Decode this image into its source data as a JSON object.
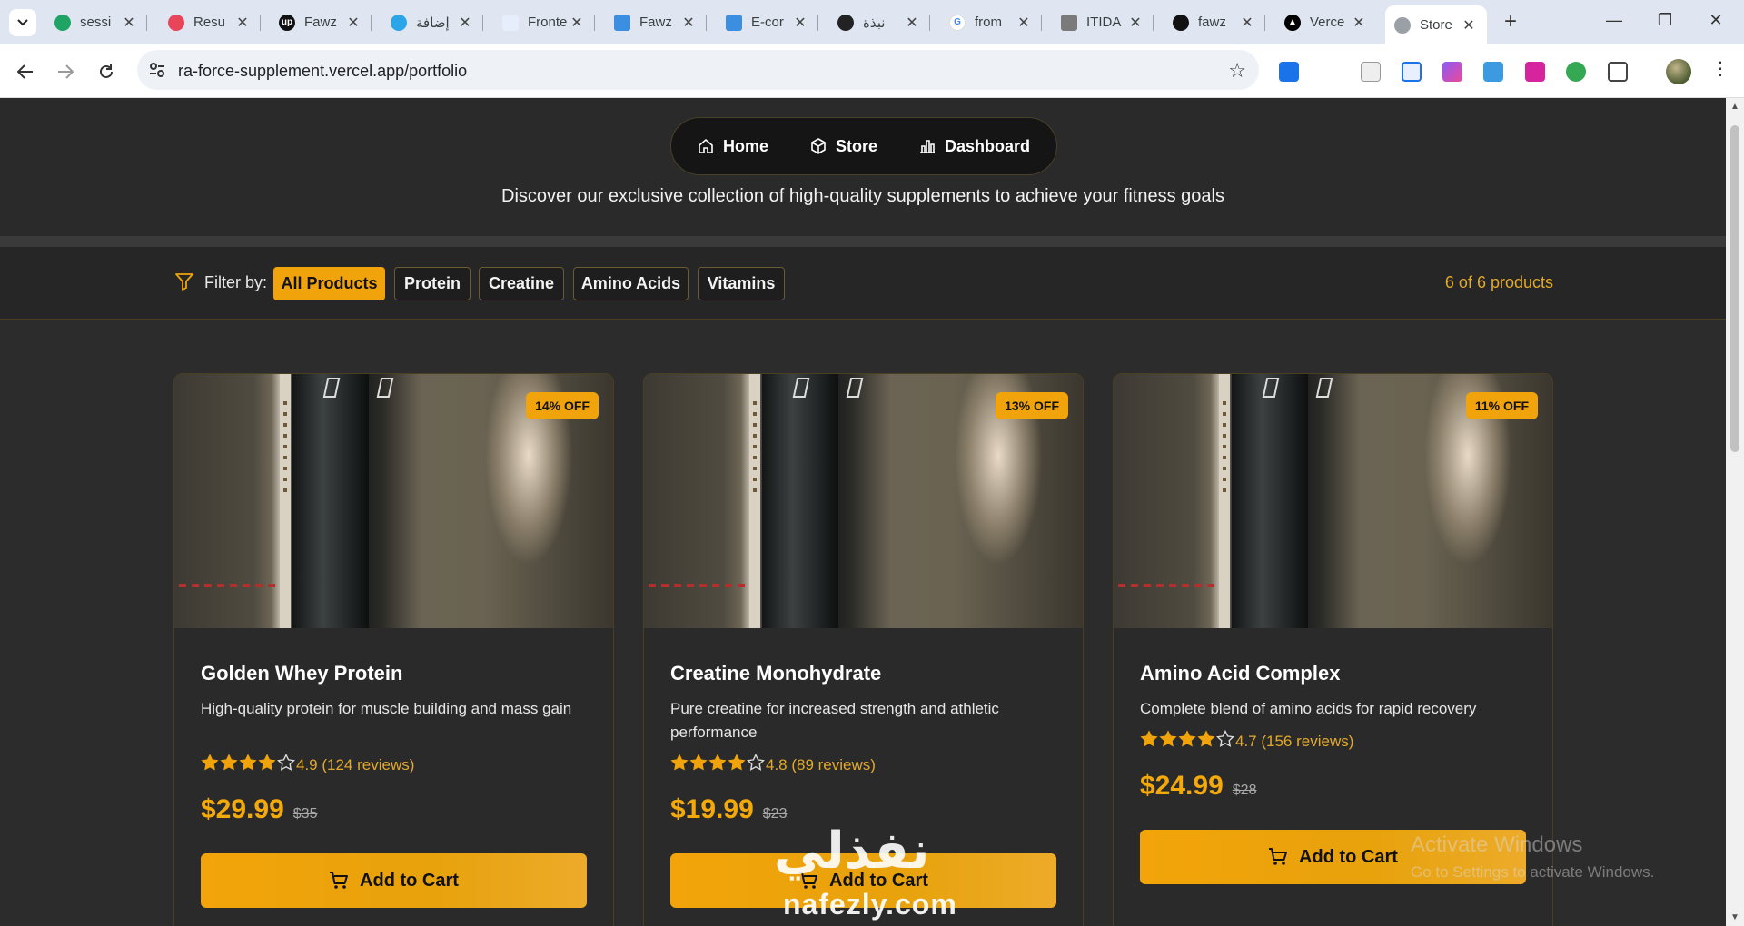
{
  "browser": {
    "tabs": [
      {
        "title": "sessi",
        "favicon": "drive-icon",
        "color": "#1fa463"
      },
      {
        "title": "Resu",
        "favicon": "resume-icon",
        "color": "#e8455b"
      },
      {
        "title": "Fawz",
        "favicon": "upwork-icon",
        "color": "#111111"
      },
      {
        "title": "إضافة",
        "favicon": "circle-icon",
        "color": "#2aa5e8"
      },
      {
        "title": "Fronte",
        "favicon": "page-icon",
        "color": "#8ab4f8"
      },
      {
        "title": "Fawz",
        "favicon": "flutter-icon",
        "color": "#3c8fe0"
      },
      {
        "title": "E-cor",
        "favicon": "flutter-icon",
        "color": "#3c8fe0"
      },
      {
        "title": "نبذة",
        "favicon": "openai-icon",
        "color": "#222222"
      },
      {
        "title": "from",
        "favicon": "google-icon",
        "color": "#4285f4"
      },
      {
        "title": "ITIDA",
        "favicon": "itida-icon",
        "color": "#7a7a7a"
      },
      {
        "title": "fawz",
        "favicon": "github-icon",
        "color": "#111111"
      },
      {
        "title": "Verce",
        "favicon": "vercel-icon",
        "color": "#000000"
      },
      {
        "title": "Store",
        "favicon": "globe-icon",
        "color": "#9aa0a6"
      }
    ],
    "url": "ra-force-supplement.vercel.app/portfolio"
  },
  "nav": {
    "home": "Home",
    "store": "Store",
    "dashboard": "Dashboard"
  },
  "tagline": "Discover our exclusive collection of high-quality supplements to achieve your fitness goals",
  "filter": {
    "label": "Filter by:",
    "options": [
      "All Products",
      "Protein",
      "Creatine",
      "Amino Acids",
      "Vitamins"
    ],
    "active": "All Products",
    "count": "6 of 6 products"
  },
  "products": [
    {
      "badge": "14% OFF",
      "name": "Golden Whey Protein",
      "description": "High-quality protein for muscle building and mass gain",
      "stars": 4,
      "rating_text": "4.9 (124 reviews)",
      "price": "$29.99",
      "old_price": "$35",
      "cta": "Add to Cart"
    },
    {
      "badge": "13% OFF",
      "name": "Creatine Monohydrate",
      "description": "Pure creatine for increased strength and athletic performance",
      "stars": 4,
      "rating_text": "4.8 (89 reviews)",
      "price": "$19.99",
      "old_price": "$23",
      "cta": "Add to Cart"
    },
    {
      "badge": "11% OFF",
      "name": "Amino Acid Complex",
      "description": "Complete blend of amino acids for rapid recovery",
      "stars": 4,
      "rating_text": "4.7 (156 reviews)",
      "price": "$24.99",
      "old_price": "$28",
      "cta": "Add to Cart"
    }
  ],
  "watermarks": {
    "activate_title": "Activate Windows",
    "activate_sub": "Go to Settings to activate Windows.",
    "logo": "نفذلي",
    "site": "nafezly.com"
  },
  "colors": {
    "accent": "#f0a30a",
    "rating": "#e2a92a",
    "background": "#2c2c2c"
  }
}
